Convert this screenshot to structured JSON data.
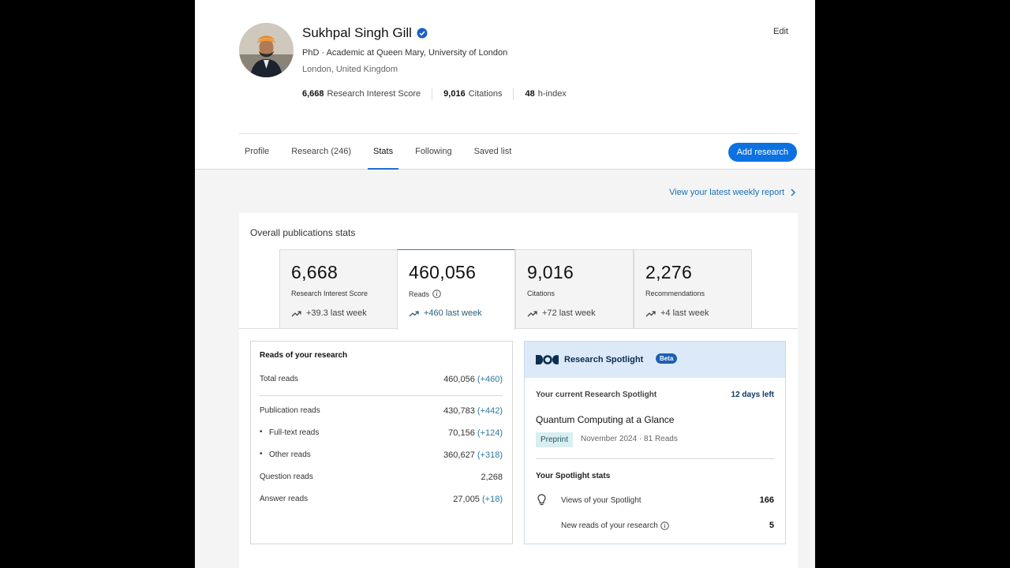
{
  "profile": {
    "name": "Sukhpal Singh Gill",
    "headline": "PhD · Academic at Queen Mary, University of London",
    "location": "London, United Kingdom",
    "edit_label": "Edit",
    "metrics": [
      {
        "value": "6,668",
        "label": "Research Interest Score"
      },
      {
        "value": "9,016",
        "label": "Citations"
      },
      {
        "value": "48",
        "label": "h-index"
      }
    ]
  },
  "tabs": [
    "Profile",
    "Research (246)",
    "Stats",
    "Following",
    "Saved list"
  ],
  "active_tab": "Stats",
  "add_research_label": "Add research",
  "weekly_report_label": "View your latest weekly report",
  "overall": {
    "title": "Overall publications stats",
    "cards": [
      {
        "value": "6,668",
        "label": "Research Interest Score",
        "delta": "+39.3 last week"
      },
      {
        "value": "460,056",
        "label": "Reads",
        "delta": "+460 last week"
      },
      {
        "value": "9,016",
        "label": "Citations",
        "delta": "+72 last week"
      },
      {
        "value": "2,276",
        "label": "Recommendations",
        "delta": "+4 last week"
      }
    ]
  },
  "reads": {
    "title": "Reads of your research",
    "rows": [
      {
        "label": "Total reads",
        "value": "460,056",
        "delta": "(+460)"
      },
      {
        "label": "Publication reads",
        "value": "430,783",
        "delta": "(+442)"
      },
      {
        "label": "Full-text reads",
        "value": "70,156",
        "delta": "(+124)"
      },
      {
        "label": "Other reads",
        "value": "360,627",
        "delta": "(+318)"
      },
      {
        "label": "Question reads",
        "value": "2,268",
        "delta": ""
      },
      {
        "label": "Answer reads",
        "value": "27,005",
        "delta": "(+18)"
      }
    ]
  },
  "spotlight": {
    "title": "Research Spotlight",
    "badge": "Beta",
    "current_label": "Your current Research Spotlight",
    "days_left": "12 days left",
    "paper_title": "Quantum Computing at a Glance",
    "paper_type": "Preprint",
    "paper_meta": "November 2024 · 81 Reads",
    "stats_title": "Your Spotlight stats",
    "stats": [
      {
        "label": "Views of your Spotlight",
        "value": "166"
      },
      {
        "label": "New reads of your research",
        "value": "5"
      }
    ]
  },
  "colors": {
    "accent": "#0d72e0",
    "link": "#1a6fb8",
    "delta": "#2a7aa0"
  }
}
